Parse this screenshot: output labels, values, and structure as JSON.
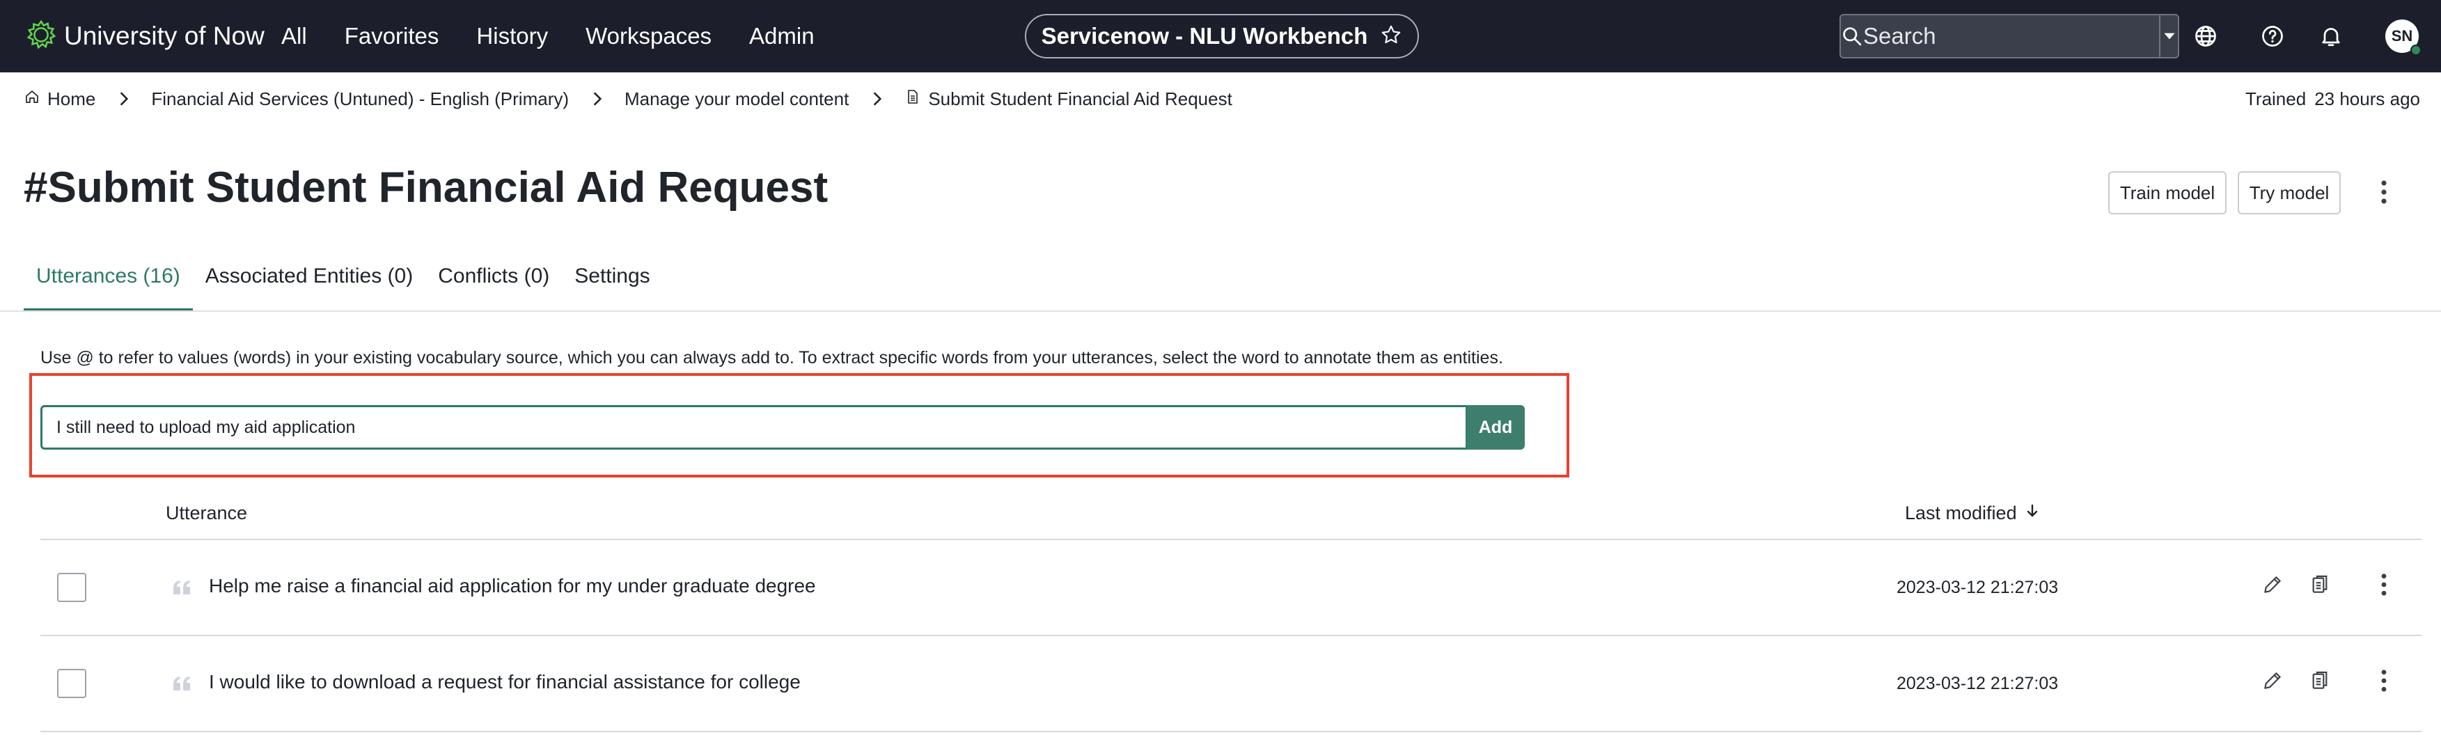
{
  "topbar": {
    "brand_name": "University of Now",
    "brand_logo_icon": "gear-leaf-logo-icon",
    "nav": [
      "All",
      "Favorites",
      "History",
      "Workspaces",
      "Admin"
    ],
    "context_title": "Servicenow - NLU Workbench",
    "context_star_icon": "star-outline-icon",
    "search": {
      "placeholder": "Search",
      "value": ""
    },
    "icons": [
      "globe-icon",
      "help-circle-icon",
      "bell-icon"
    ],
    "avatar_initials": "SN",
    "avatar_status_color": "#2e8b57",
    "background_color": "#1c1f2b"
  },
  "breadcrumb": {
    "items": [
      "Home",
      "Financial Aid Services (Untuned) - English (Primary)",
      "Manage your model content",
      "Submit Student Financial Aid Request"
    ],
    "trained_label": "Trained",
    "trained_time": "23 hours ago"
  },
  "page": {
    "title": "#Submit Student Financial Aid Request",
    "actions": {
      "train": "Train model",
      "try": "Try model"
    }
  },
  "tabs": {
    "items": [
      "Utterances (16)",
      "Associated Entities (0)",
      "Conflicts (0)",
      "Settings"
    ],
    "active_index": 0,
    "accent_color": "#2d7a64"
  },
  "editor": {
    "description": "Use @ to refer to values (words) in your existing vocabulary source, which you can always add to. To extract specific words from your utterances, select the word to annotate them as entities.",
    "input_value": "I still need to upload my aid application",
    "add_label": "Add",
    "highlight_color": "#e8432f"
  },
  "table": {
    "headers": {
      "utterance": "Utterance",
      "last_modified": "Last modified"
    },
    "sort": "descending",
    "rows": [
      {
        "text": "Help me raise a financial aid application for my under graduate degree",
        "modified": "2023-03-12 21:27:03"
      },
      {
        "text": "I would like to download a request for financial assistance for college",
        "modified": "2023-03-12 21:27:03"
      }
    ]
  }
}
